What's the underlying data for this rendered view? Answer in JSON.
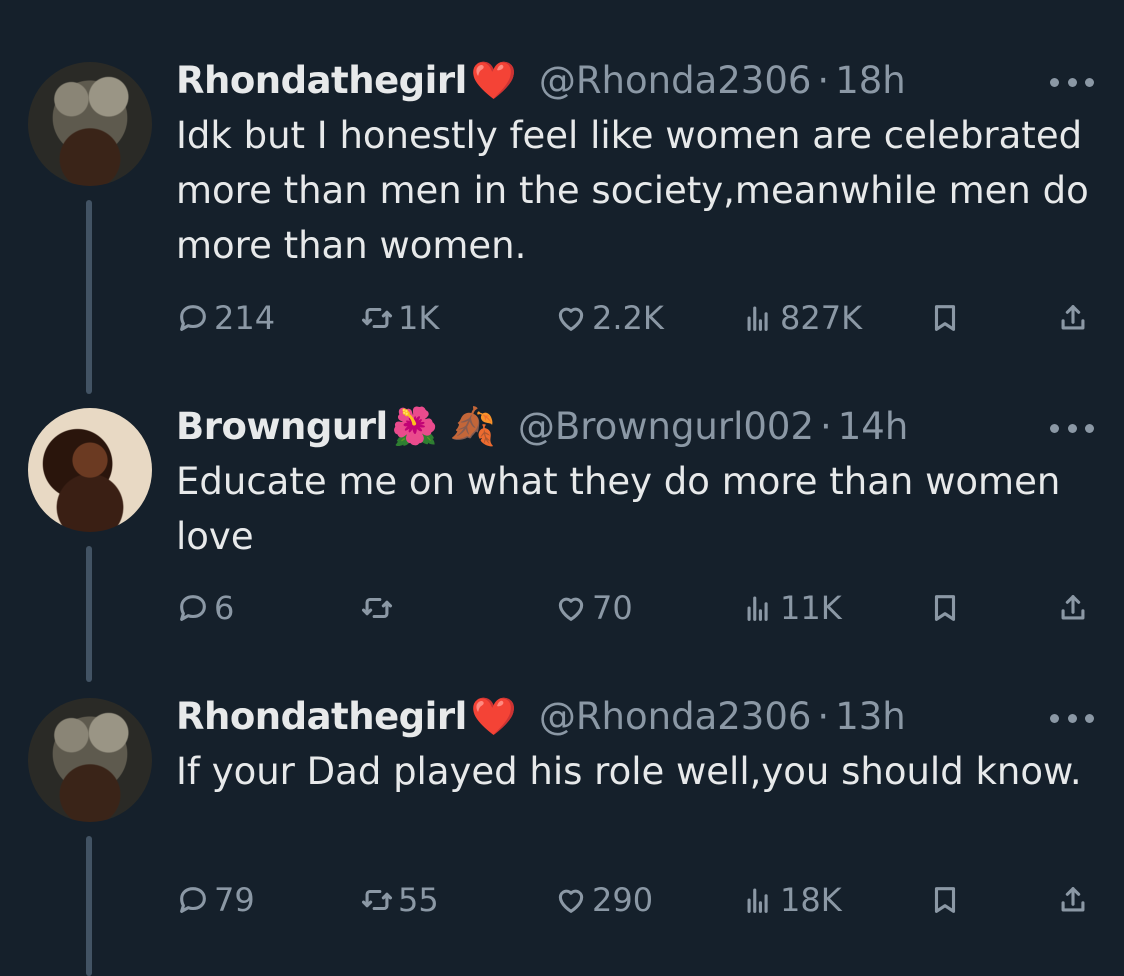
{
  "tweets": [
    {
      "name": "Rhondathegirl",
      "emojis": [
        "❤️"
      ],
      "handle": "@Rhonda2306",
      "dot": "·",
      "time": "18h",
      "text": "Idk but I honestly feel like women are celebrated more than men in the society,meanwhile men do more than women.",
      "replies": "214",
      "retweets": "1K",
      "likes": "2.2K",
      "views": "827K"
    },
    {
      "name": "Browngurl",
      "emojis": [
        "🌺",
        "🍂"
      ],
      "handle": "@Browngurl002",
      "dot": "·",
      "time": "14h",
      "text": "Educate me on what they do more than women love",
      "replies": "6",
      "retweets": "",
      "likes": "70",
      "views": "11K"
    },
    {
      "name": "Rhondathegirl",
      "emojis": [
        "❤️"
      ],
      "handle": "@Rhonda2306",
      "dot": "·",
      "time": "13h",
      "text": "If your Dad played his role well,you should know.",
      "replies": "79",
      "retweets": "55",
      "likes": "290",
      "views": "18K"
    }
  ],
  "icons": {
    "reply": "reply-icon",
    "retweet": "retweet-icon",
    "like": "heart-icon",
    "views": "views-icon",
    "bookmark": "bookmark-icon",
    "share": "share-icon",
    "more": "more-icon"
  },
  "colors": {
    "background": "#15202b",
    "text": "#e7e9ea",
    "secondary": "#8b98a5",
    "thread_line": "#425364"
  }
}
